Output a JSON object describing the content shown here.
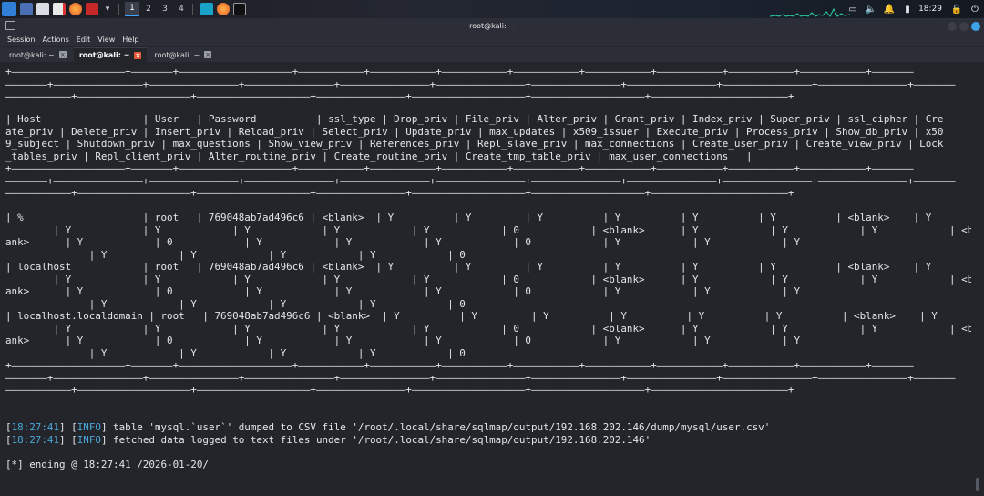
{
  "taskbar": {
    "workspaces": [
      "1",
      "2",
      "3",
      "4"
    ],
    "clock": "18:29"
  },
  "window": {
    "title": "root@kali: ~"
  },
  "menu": [
    "Session",
    "Actions",
    "Edit",
    "View",
    "Help"
  ],
  "tabs": [
    {
      "label": "root@kali: ~",
      "active": false
    },
    {
      "label": "root@kali: ~",
      "active": true
    },
    {
      "label": "root@kali: ~",
      "active": false
    }
  ],
  "terminal": {
    "lines": [
      "+———————————————————+———————+———————————————————+———————————+———————————+———————————+———————————+———————————+———————————+———————————+———————————+———————",
      "———————+———————————————+———————————————+———————————————+———————————————+———————————————+———————————————+———————————————+———————————————+———————————————+———————",
      "———————————+———————————————————+———————————————————+———————————————+———————————————————+———————————————————+———————————————————————+",
      "| Host                 | User   | Password          | ssl_type | Drop_priv | File_priv | Alter_priv | Grant_priv | Index_priv | Super_priv | ssl_cipher | Cre",
      "ate_priv | Delete_priv | Insert_priv | Reload_priv | Select_priv | Update_priv | max_updates | x509_issuer | Execute_priv | Process_priv | Show_db_priv | x50",
      "9_subject | Shutdown_priv | max_questions | Show_view_priv | References_priv | Repl_slave_priv | max_connections | Create_user_priv | Create_view_priv | Lock",
      "_tables_priv | Repl_client_priv | Alter_routine_priv | Create_routine_priv | Create_tmp_table_priv | max_user_connections   |",
      "+———————————————————+———————+———————————————————+———————————+———————————+———————————+———————————+———————————+———————————+———————————+———————————+———————",
      "———————+———————————————+———————————————+———————————————+———————————————+———————————————+———————————————+———————————————+———————————————+———————————————+———————",
      "———————————+———————————————————+———————————————————+———————————————+———————————————————+———————————————————+———————————————————————+",
      "| %                    | root   | 769048ab7ad496c6 | <blank>  | Y          | Y         | Y          | Y          | Y          | Y          | <blank>    | Y",
      "        | Y            | Y            | Y            | Y            | Y            | 0            | <blank>      | Y            | Y            | Y            | <bl",
      "ank>      | Y            | 0            | Y            | Y            | Y            | 0            | Y            | Y            | Y",
      "              | Y            | Y            | Y            | Y            | 0",
      "| localhost            | root   | 769048ab7ad496c6 | <blank>  | Y          | Y         | Y          | Y          | Y          | Y          | <blank>    | Y",
      "        | Y            | Y            | Y            | Y            | Y            | 0            | <blank>      | Y            | Y            | Y            | <bl",
      "ank>      | Y            | 0            | Y            | Y            | Y            | 0            | Y            | Y            | Y",
      "              | Y            | Y            | Y            | Y            | 0",
      "| localhost.localdomain | root   | 769048ab7ad496c6 | <blank>  | Y          | Y         | Y          | Y          | Y          | Y          | <blank>    | Y",
      "        | Y            | Y            | Y            | Y            | Y            | 0            | <blank>      | Y            | Y            | Y            | <bl",
      "ank>      | Y            | 0            | Y            | Y            | Y            | 0            | Y            | Y            | Y",
      "              | Y            | Y            | Y            | Y            | 0",
      "+———————————————————+———————+———————————————————+———————————+———————————+———————————+———————————+———————————+———————————+———————————+———————————+———————",
      "———————+———————————————+———————————————+———————————————+———————————————+———————————————+———————————————+———————————————+———————————————+———————————————+———————",
      "———————————+———————————————————+———————————————————+———————————————+———————————————————+———————————————————+———————————————————————+"
    ],
    "log1": {
      "time": "18:27:41",
      "level": "INFO",
      "text": " table 'mysql.`user`' dumped to CSV file '/root/.local/share/sqlmap/output/192.168.202.146/dump/mysql/user.csv'"
    },
    "log2": {
      "time": "18:27:41",
      "level": "INFO",
      "text": " fetched data logged to text files under '/root/.local/share/sqlmap/output/192.168.202.146'"
    },
    "ending": "[*] ending @ 18:27:41 /2026-01-20/"
  },
  "colors": {
    "accent_blue": "#4aa8d8",
    "background": "#23252b"
  }
}
